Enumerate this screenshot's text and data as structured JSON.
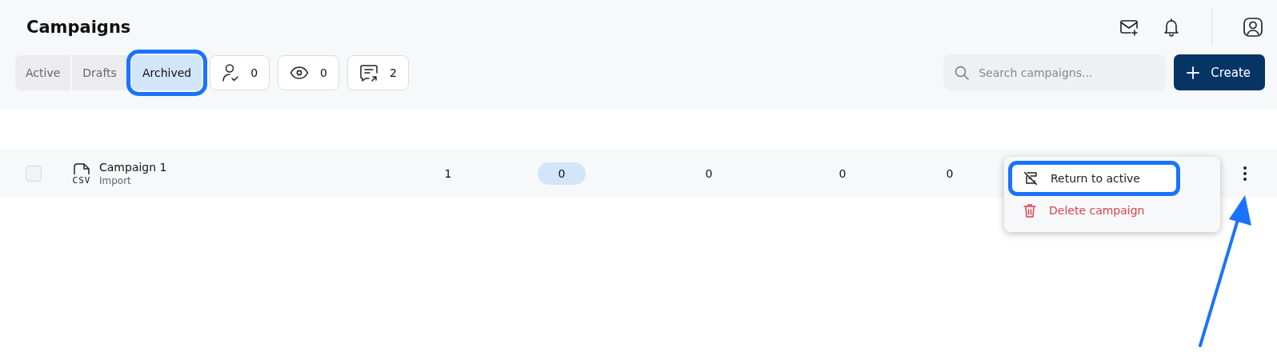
{
  "page": {
    "title": "Campaigns"
  },
  "tabs": [
    {
      "label": "Active",
      "selected": false
    },
    {
      "label": "Drafts",
      "selected": false
    },
    {
      "label": "Archived",
      "selected": true
    }
  ],
  "stats": [
    {
      "kind": "contacts",
      "count": "0"
    },
    {
      "kind": "views",
      "count": "0"
    },
    {
      "kind": "replies",
      "count": "2"
    }
  ],
  "search": {
    "placeholder": "Search campaigns..."
  },
  "create_button": {
    "label": "Create"
  },
  "rows": [
    {
      "checked": false,
      "name": "Campaign 1",
      "source": "Import",
      "file_type": "CSV",
      "cells": [
        {
          "kind": "plain",
          "text": "1"
        },
        {
          "kind": "pill",
          "text": "0"
        },
        {
          "kind": "plain",
          "text": "0"
        },
        {
          "kind": "plain",
          "text": "0"
        },
        {
          "kind": "plain",
          "text": "0"
        }
      ]
    }
  ],
  "menu": {
    "items": [
      {
        "kind": "restore",
        "label": "Return to active",
        "highlighted": true
      },
      {
        "kind": "delete",
        "label": "Delete campaign",
        "highlighted": false
      }
    ]
  }
}
